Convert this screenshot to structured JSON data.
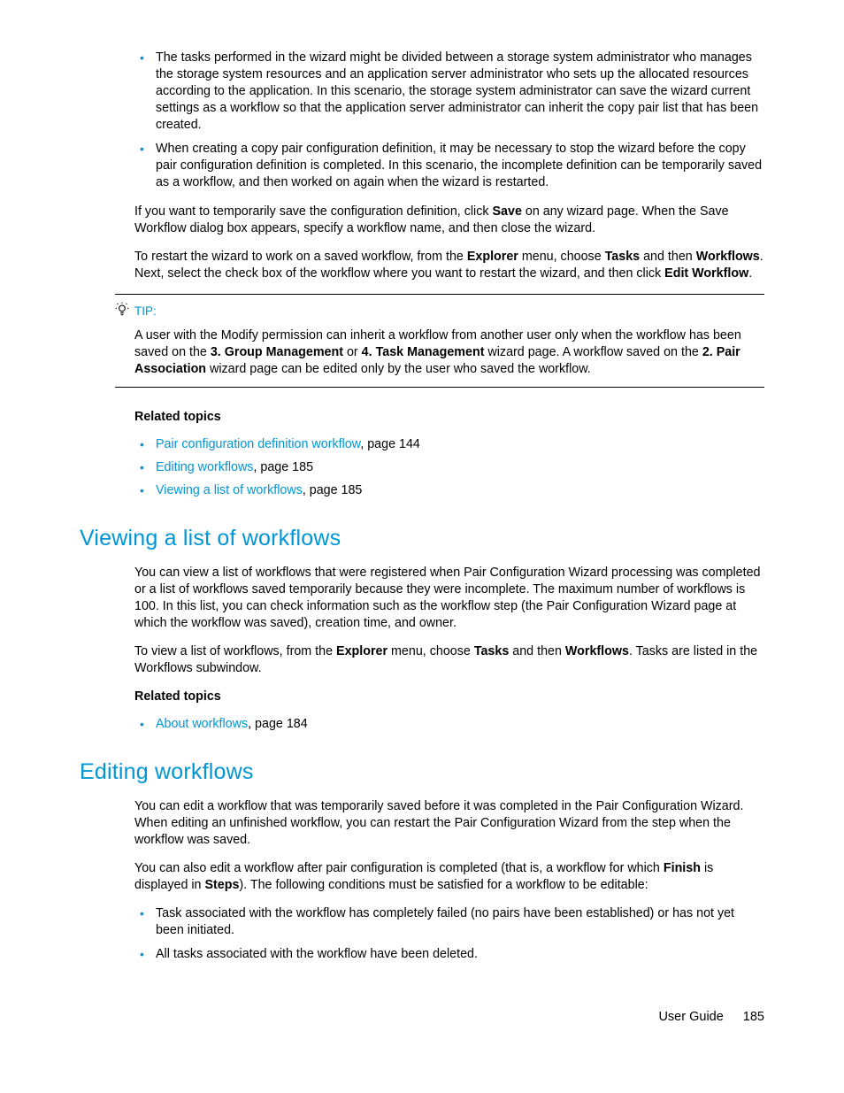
{
  "bullets_top": [
    "The tasks performed in the wizard might be divided between a storage system administrator who manages the storage system resources and an application server administrator who sets up the allocated resources according to the application. In this scenario, the storage system administrator can save the wizard current settings as a workflow so that the application server administrator can inherit the copy pair list that has been created.",
    "When creating a copy pair configuration definition, it may be necessary to stop the wizard before the copy pair configuration definition is completed. In this scenario, the incomplete definition can be temporarily saved as a workflow, and then worked on again when the wizard is restarted."
  ],
  "para_save": {
    "pre": "If you want to temporarily save the configuration definition, click ",
    "b1": "Save",
    "post": " on any wizard page. When the Save Workflow dialog box appears, specify a workflow name, and then close the wizard."
  },
  "para_restart": {
    "t1": "To restart the wizard to work on a saved workflow, from the ",
    "b1": "Explorer",
    "t2": " menu, choose ",
    "b2": "Tasks",
    "t3": " and then ",
    "b3": "Workflows",
    "t4": ". Next, select the check box of the workflow where you want to restart the wizard, and then click ",
    "b4": "Edit Workflow",
    "t5": "."
  },
  "tip_label": "TIP:",
  "tip_body": {
    "t1": "A user with the Modify permission can inherit a workflow from another user only when the workflow has been saved on the ",
    "b1": "3. Group Management",
    "t2": " or ",
    "b2": "4. Task Management",
    "t3": " wizard page. A workflow saved on the ",
    "b3": "2. Pair Association",
    "t4": " wizard page can be edited only by the user who saved the workflow."
  },
  "related_label": "Related topics",
  "related1": [
    {
      "link": "Pair configuration definition workflow",
      "suffix": ", page 144"
    },
    {
      "link": "Editing workflows",
      "suffix": ", page 185"
    },
    {
      "link": "Viewing a list of workflows",
      "suffix": ", page 185"
    }
  ],
  "h_viewing": "Viewing a list of workflows",
  "viewing_p1": "You can view a list of workflows that were registered when Pair Configuration Wizard processing was completed or a list of workflows saved temporarily because they were incomplete. The maximum number of workflows is 100. In this list, you can check information such as the workflow step (the Pair Configuration Wizard page at which the workflow was saved), creation time, and owner.",
  "viewing_p2": {
    "t1": "To view a list of workflows, from the ",
    "b1": "Explorer",
    "t2": " menu, choose ",
    "b2": "Tasks",
    "t3": " and then ",
    "b3": "Workflows",
    "t4": ". Tasks are listed in the Workflows subwindow."
  },
  "related2": [
    {
      "link": "About workflows",
      "suffix": ", page 184"
    }
  ],
  "h_editing": "Editing workflows",
  "editing_p1": "You can edit a workflow that was temporarily saved before it was completed in the Pair Configuration Wizard. When editing an unfinished workflow,  you can restart the Pair Configuration Wizard from the step when the workflow was saved.",
  "editing_p2": {
    "t1": "You can also edit a workflow after pair configuration is completed (that is, a workflow for which ",
    "b1": "Finish",
    "t2": " is displayed in ",
    "b2": "Steps",
    "t3": ").  The following conditions must be satisfied for a workflow to be editable:"
  },
  "editing_bullets": [
    "Task associated with the workflow has completely failed (no pairs have been established) or has not yet been initiated.",
    "All tasks associated with the workflow have been deleted."
  ],
  "footer_label": "User Guide",
  "footer_page": "185"
}
